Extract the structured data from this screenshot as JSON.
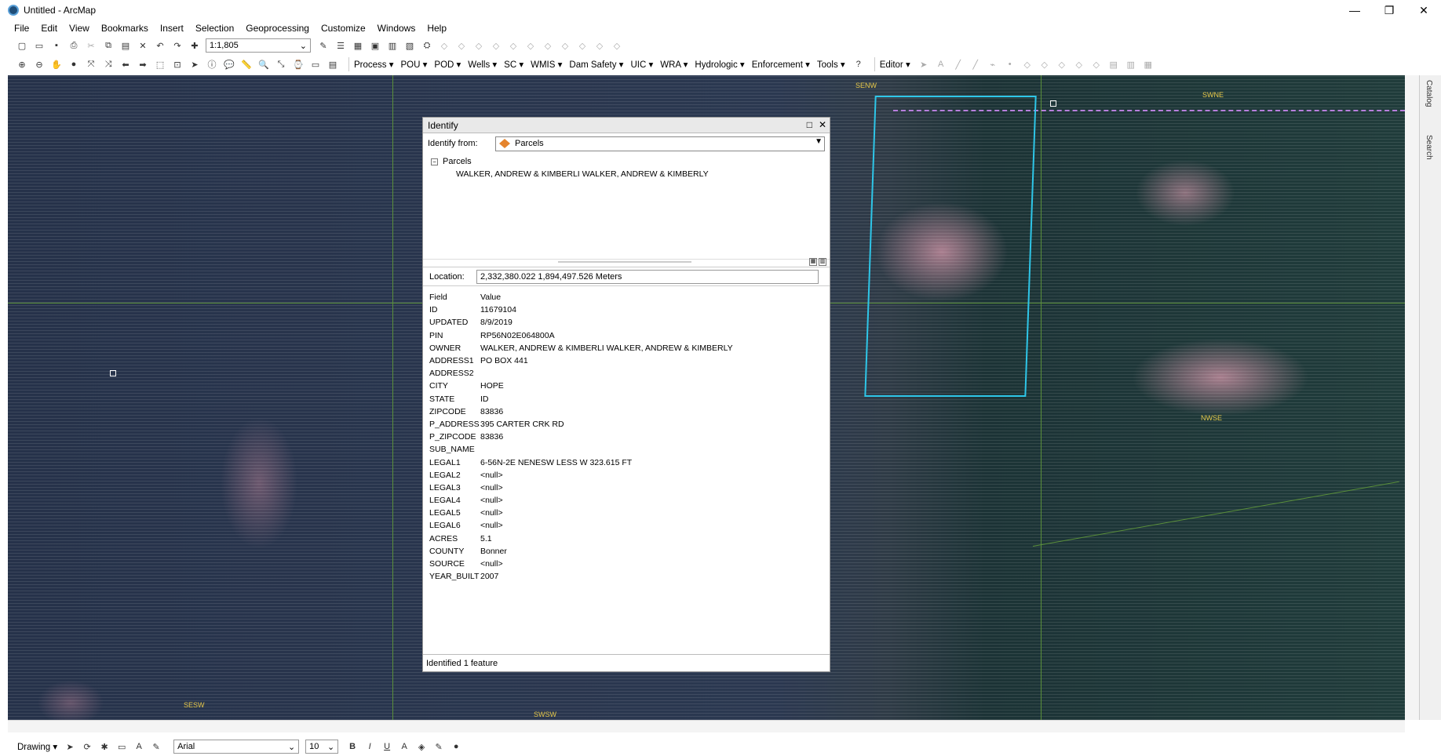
{
  "window": {
    "title": "Untitled - ArcMap",
    "controls": [
      "—",
      "❐",
      "✕"
    ]
  },
  "menu": [
    "File",
    "Edit",
    "View",
    "Bookmarks",
    "Insert",
    "Selection",
    "Geoprocessing",
    "Customize",
    "Windows",
    "Help"
  ],
  "toolbar": {
    "scale": "1:1,805",
    "menus": [
      "Process",
      "POU",
      "POD",
      "Wells",
      "SC",
      "WMIS",
      "Dam Safety",
      "UIC",
      "WRA",
      "Hydrologic",
      "Enforcement",
      "Tools"
    ],
    "editor": "Editor"
  },
  "map": {
    "labels": [
      "SENW",
      "SWNE",
      "NWSE",
      "SESW",
      "SWSW"
    ],
    "parcel_color": "#2ec6e8"
  },
  "identify": {
    "title": "Identify",
    "from_label": "Identify from:",
    "from_value": "Parcels",
    "tree_layer": "Parcels",
    "tree_feature": "WALKER, ANDREW & KIMBERLI WALKER, ANDREW & KIMBERLY",
    "location_label": "Location:",
    "location_value": "2,332,380.022  1,894,497.526 Meters",
    "field_header": "Field",
    "value_header": "Value",
    "fields": [
      {
        "field": "ID",
        "value": "11679104"
      },
      {
        "field": "UPDATED",
        "value": "8/9/2019"
      },
      {
        "field": "PIN",
        "value": "RP56N02E064800A"
      },
      {
        "field": "OWNER",
        "value": "WALKER, ANDREW & KIMBERLI WALKER, ANDREW & KIMBERLY"
      },
      {
        "field": "ADDRESS1",
        "value": "PO BOX 441"
      },
      {
        "field": "ADDRESS2",
        "value": ""
      },
      {
        "field": "CITY",
        "value": "HOPE"
      },
      {
        "field": "STATE",
        "value": "ID"
      },
      {
        "field": "ZIPCODE",
        "value": "83836"
      },
      {
        "field": "P_ADDRESS",
        "value": "395 CARTER CRK RD"
      },
      {
        "field": "P_ZIPCODE",
        "value": "83836"
      },
      {
        "field": "SUB_NAME",
        "value": ""
      },
      {
        "field": "LEGAL1",
        "value": "6-56N-2E NENESW LESS W 323.615 FT"
      },
      {
        "field": "LEGAL2",
        "value": "<null>"
      },
      {
        "field": "LEGAL3",
        "value": "<null>"
      },
      {
        "field": "LEGAL4",
        "value": "<null>"
      },
      {
        "field": "LEGAL5",
        "value": "<null>"
      },
      {
        "field": "LEGAL6",
        "value": "<null>"
      },
      {
        "field": "ACRES",
        "value": "5.1"
      },
      {
        "field": "COUNTY",
        "value": "Bonner"
      },
      {
        "field": "SOURCE",
        "value": "<null>"
      },
      {
        "field": "YEAR_BUILT",
        "value": "2007"
      }
    ],
    "status": "Identified 1 feature"
  },
  "side_tabs": [
    "Catalog",
    "Search"
  ],
  "drawing": {
    "label": "Drawing",
    "font": "Arial",
    "size": "10"
  }
}
